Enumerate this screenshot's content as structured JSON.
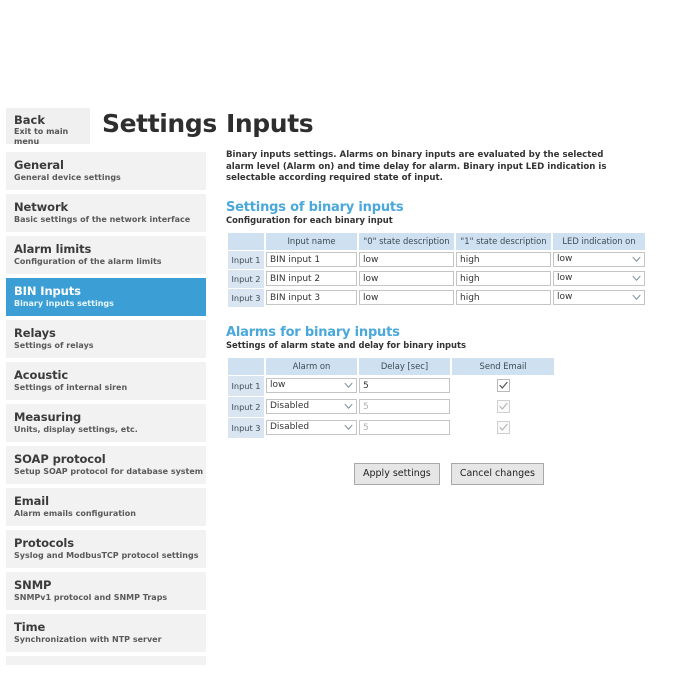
{
  "header": {
    "back_title": "Back",
    "back_sub": "Exit to main menu",
    "settings_title": "Settings",
    "page_title": "Inputs"
  },
  "sidebar": {
    "items": [
      {
        "title": "General",
        "sub": "General device settings",
        "active": false
      },
      {
        "title": "Network",
        "sub": "Basic settings of the network interface",
        "active": false
      },
      {
        "title": "Alarm limits",
        "sub": "Configuration of the alarm limits",
        "active": false
      },
      {
        "title": "BIN Inputs",
        "sub": "Binary inputs settings",
        "active": true
      },
      {
        "title": "Relays",
        "sub": "Settings of relays",
        "active": false
      },
      {
        "title": "Acoustic",
        "sub": "Settings of internal siren",
        "active": false
      },
      {
        "title": "Measuring",
        "sub": "Units, display settings, etc.",
        "active": false
      },
      {
        "title": "SOAP protocol",
        "sub": "Setup SOAP protocol for database system",
        "active": false
      },
      {
        "title": "Email",
        "sub": "Alarm emails configuration",
        "active": false
      },
      {
        "title": "Protocols",
        "sub": "Syslog and ModbusTCP protocol settings",
        "active": false
      },
      {
        "title": "SNMP",
        "sub": "SNMPv1 protocol and SNMP Traps",
        "active": false
      },
      {
        "title": "Time",
        "sub": "Synchronization with NTP server",
        "active": false
      }
    ]
  },
  "main": {
    "description": "Binary inputs settings. Alarms on binary inputs are evaluated by the selected alarm level (Alarm on) and time delay for alarm. Binary input LED indication is selectable according required state of input.",
    "section1": {
      "heading": "Settings of binary inputs",
      "subheading": "Configuration for each binary input",
      "columns": [
        "",
        "Input name",
        "\"0\" state description",
        "\"1\" state description",
        "LED indication on"
      ],
      "rows": [
        {
          "label": "Input 1",
          "input_name": "BIN input 1",
          "state0": "low",
          "state1": "high",
          "led_on": "low"
        },
        {
          "label": "Input 2",
          "input_name": "BIN input 2",
          "state0": "low",
          "state1": "high",
          "led_on": "low"
        },
        {
          "label": "Input 3",
          "input_name": "BIN input 3",
          "state0": "low",
          "state1": "high",
          "led_on": "low"
        }
      ]
    },
    "section2": {
      "heading": "Alarms for binary inputs",
      "subheading": "Settings of alarm state and delay for binary inputs",
      "columns": [
        "",
        "Alarm on",
        "Delay [sec]",
        "Send Email"
      ],
      "rows": [
        {
          "label": "Input 1",
          "alarm_on": "low",
          "delay": "5",
          "send_email": true,
          "disabled": false
        },
        {
          "label": "Input 2",
          "alarm_on": "Disabled",
          "delay": "5",
          "send_email": true,
          "disabled": true
        },
        {
          "label": "Input 3",
          "alarm_on": "Disabled",
          "delay": "5",
          "send_email": true,
          "disabled": true
        }
      ]
    },
    "buttons": {
      "apply": "Apply settings",
      "cancel": "Cancel changes"
    }
  },
  "colors": {
    "accent_blue": "#3b9fd6",
    "heading_blue": "#4aa8da",
    "table_header": "#cfe1f0",
    "row_label": "#d9e6f2",
    "sidebar_bg": "#f2f2f2"
  }
}
